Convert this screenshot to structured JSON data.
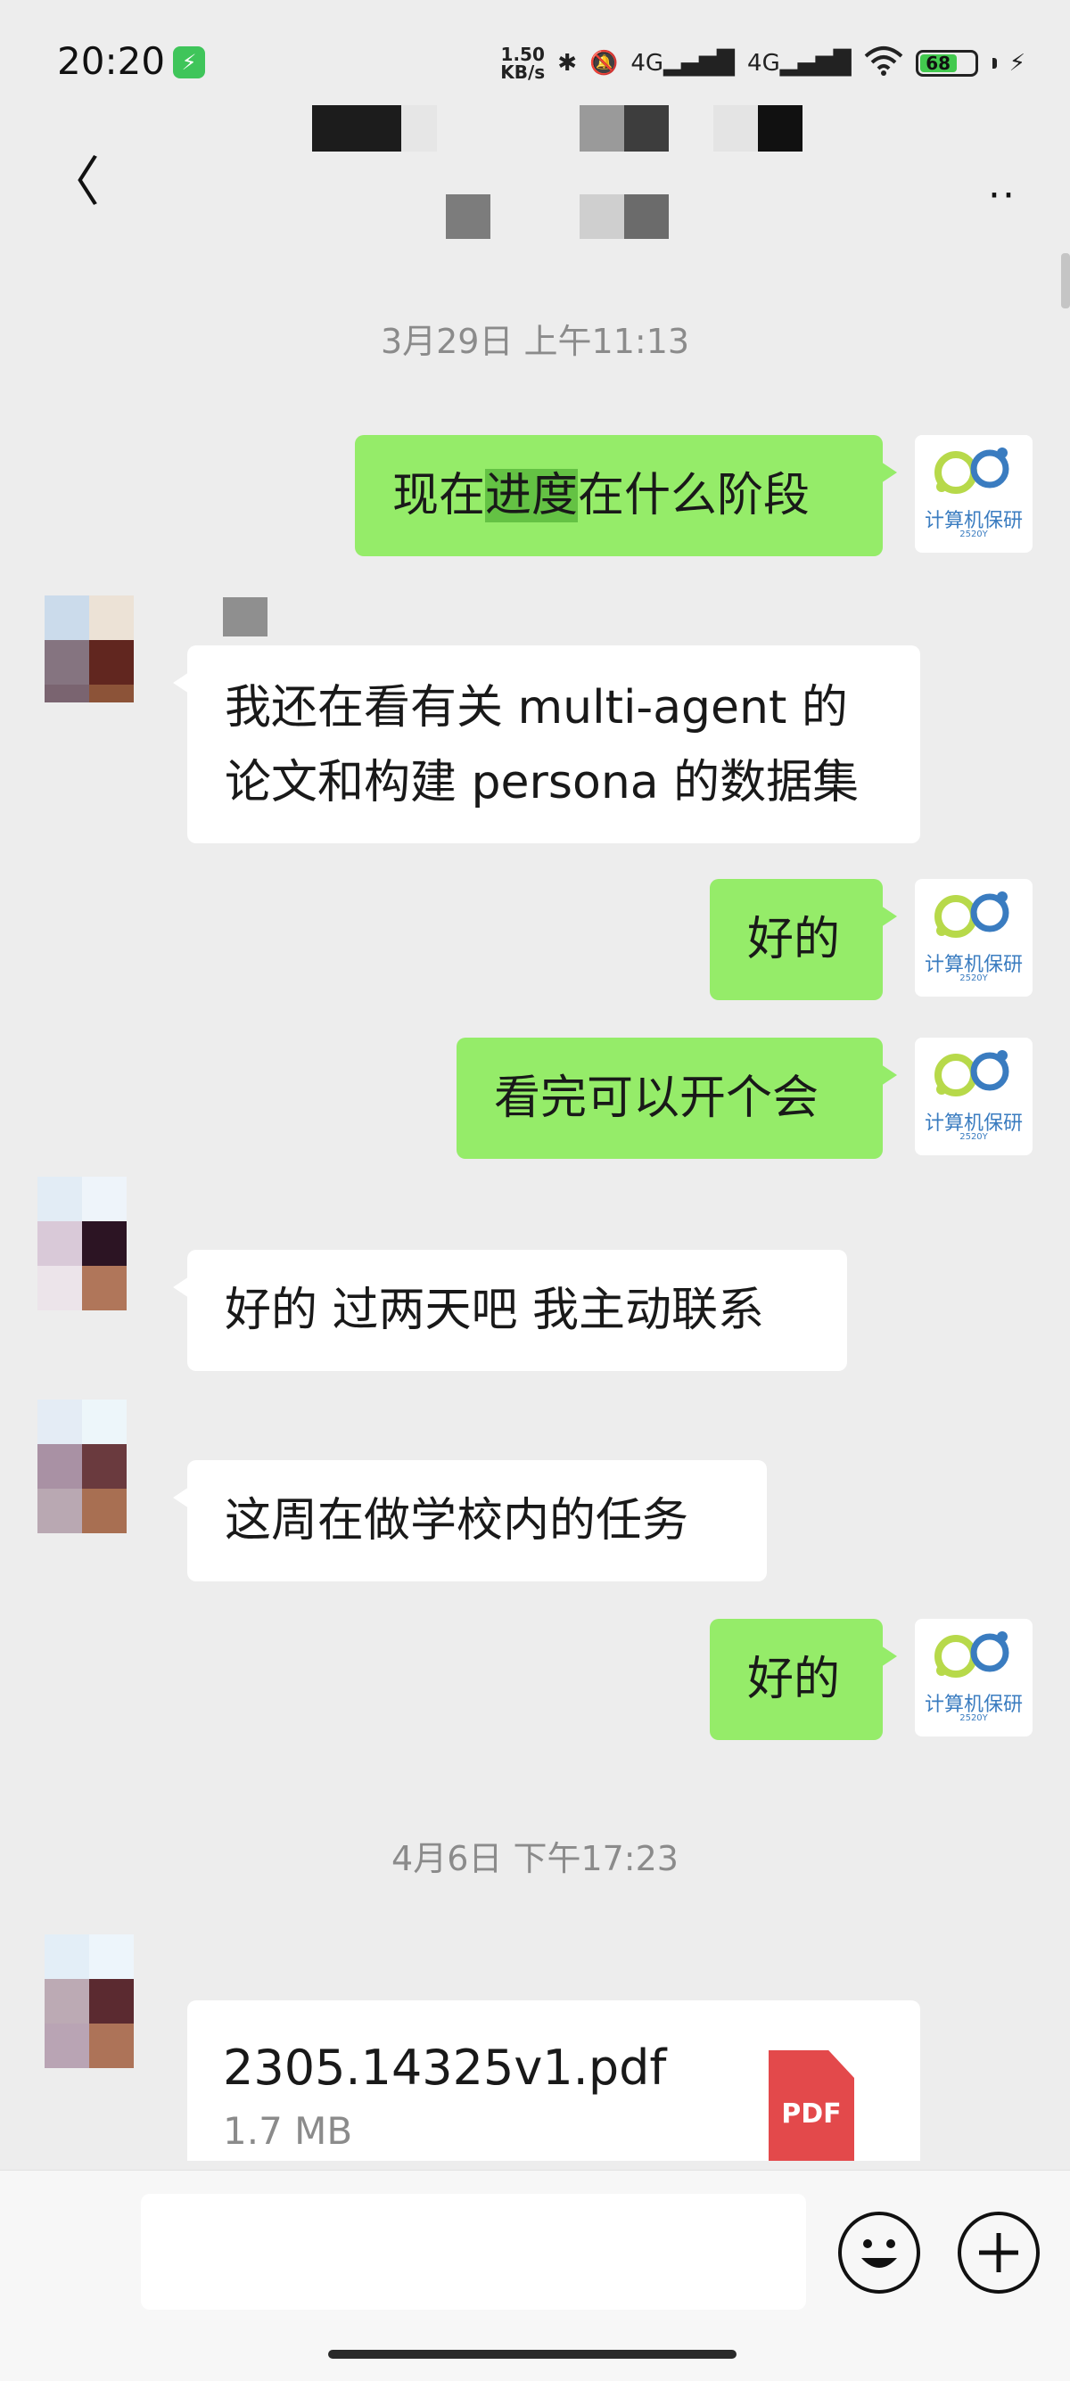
{
  "status_bar": {
    "time": "20:20",
    "charging_badge": "⚡",
    "net_speed_top": "1.50",
    "net_speed_unit": "KB/s",
    "signal_1": "4G",
    "signal_2": "4G",
    "battery_level": "68",
    "battery_fraction": 0.68
  },
  "nav": {
    "back_glyph": "〈",
    "more_glyph": "··"
  },
  "timestamps": [
    "3月29日 上午11:13",
    "4月6日 下午17:23"
  ],
  "messages": [
    {
      "from": "me",
      "text_a": "现在",
      "text_hl": "进度",
      "text_b": "在什么阶段"
    },
    {
      "from": "them",
      "line1": "我还在看有关 multi-agent 的",
      "line2": "论文和构建 persona 的数据集"
    },
    {
      "from": "me",
      "text": "好的"
    },
    {
      "from": "me",
      "text": "看完可以开个会"
    },
    {
      "from": "them",
      "text": "好的 过两天吧 我主动联系"
    },
    {
      "from": "them",
      "text": "这周在做学校内的任务"
    },
    {
      "from": "me",
      "text": "好的"
    }
  ],
  "my_avatar": {
    "logo_text": "计算机保研",
    "logo_sub": "2520Y"
  },
  "file": {
    "name": "2305.14325v1.pdf",
    "size": "1.7 MB",
    "type_label": "PDF"
  },
  "input": {
    "placeholder": ""
  },
  "colors": {
    "my_bubble": "#95ec69",
    "their_bubble": "#ffffff",
    "background": "#ededed",
    "pdf_red": "#e3494b"
  }
}
